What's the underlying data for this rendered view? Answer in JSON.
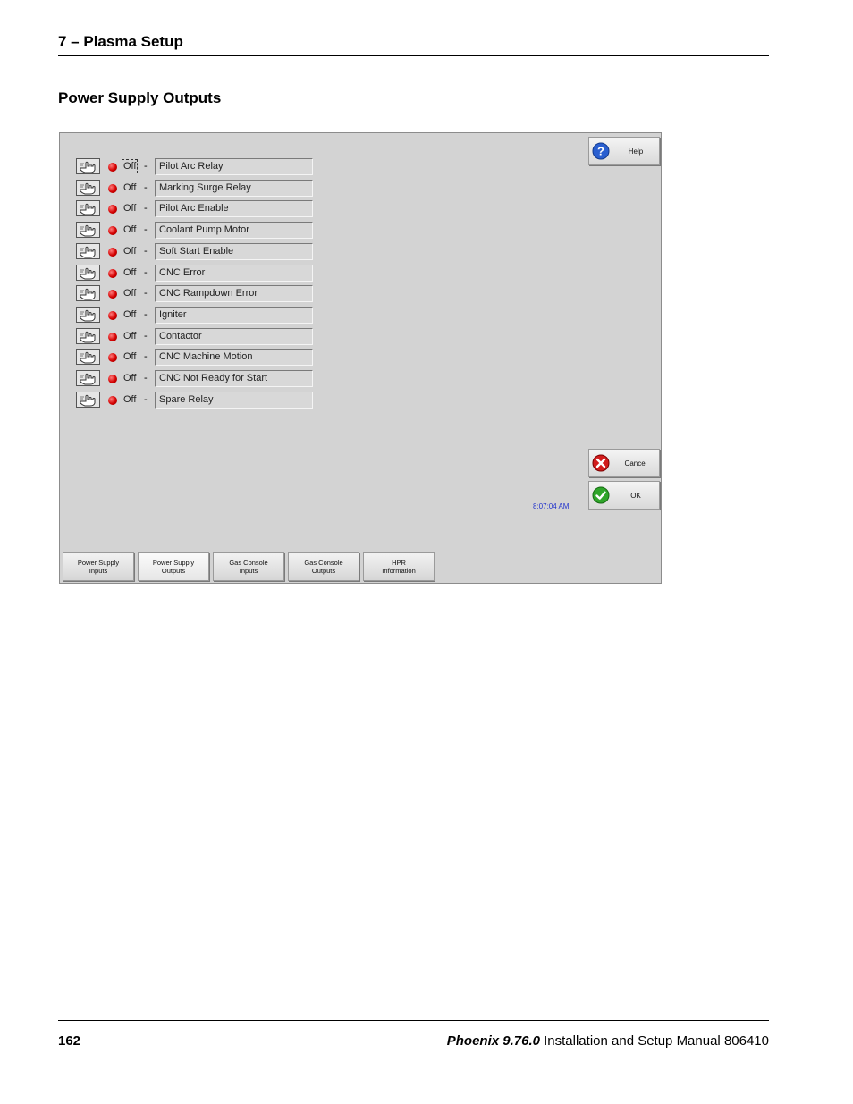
{
  "header": {
    "chapter_title": "7 – Plasma Setup"
  },
  "section": {
    "title": "Power Supply Outputs"
  },
  "outputs": [
    {
      "state": "Off",
      "label": "Pilot Arc Relay"
    },
    {
      "state": "Off",
      "label": "Marking Surge Relay"
    },
    {
      "state": "Off",
      "label": "Pilot Arc Enable"
    },
    {
      "state": "Off",
      "label": "Coolant Pump Motor"
    },
    {
      "state": "Off",
      "label": "Soft Start Enable"
    },
    {
      "state": "Off",
      "label": "CNC Error"
    },
    {
      "state": "Off",
      "label": "CNC Rampdown Error"
    },
    {
      "state": "Off",
      "label": "Igniter"
    },
    {
      "state": "Off",
      "label": "Contactor"
    },
    {
      "state": "Off",
      "label": "CNC Machine Motion"
    },
    {
      "state": "Off",
      "label": "CNC Not Ready for Start"
    },
    {
      "state": "Off",
      "label": "Spare Relay"
    }
  ],
  "separator": "-",
  "buttons": {
    "help": "Help",
    "cancel": "Cancel",
    "ok": "OK"
  },
  "clock": "8:07:04 AM",
  "tabs": [
    {
      "line1": "Power Supply",
      "line2": "Inputs"
    },
    {
      "line1": "Power Supply",
      "line2": "Outputs"
    },
    {
      "line1": "Gas Console",
      "line2": "Inputs"
    },
    {
      "line1": "Gas Console",
      "line2": "Outputs"
    },
    {
      "line1": "HPR",
      "line2": "Information"
    }
  ],
  "footer": {
    "page_number": "162",
    "product": "Phoenix 9.76.0",
    "manual": "Installation and Setup Manual",
    "part_number": "806410"
  },
  "colors": {
    "led": "#d40000",
    "clock_text": "#2233cc",
    "screen_bg": "#d3d3d3"
  }
}
